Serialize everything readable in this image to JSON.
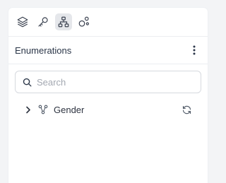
{
  "toolbar": {
    "buttons": [
      {
        "icon": "layers-icon",
        "active": false
      },
      {
        "icon": "key-icon",
        "active": false
      },
      {
        "icon": "hierarchy-icon",
        "active": true
      },
      {
        "icon": "bubbles-icon",
        "active": false
      }
    ]
  },
  "panel": {
    "title": "Enumerations"
  },
  "search": {
    "placeholder": "Search",
    "value": ""
  },
  "tree": {
    "items": [
      {
        "label": "Gender",
        "expanded": false
      }
    ]
  },
  "colors": {
    "icon": "#3b4250",
    "active_bg": "#e5e7eb",
    "refresh": "#4b5563"
  }
}
